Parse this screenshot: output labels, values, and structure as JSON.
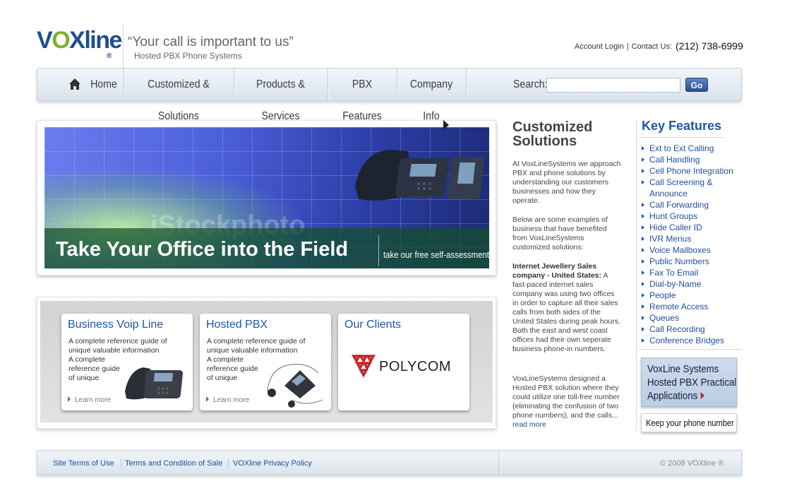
{
  "logo": {
    "part1": "V",
    "part2": "O",
    "part3": "Xline",
    "reg": "®"
  },
  "header": {
    "tagline": "“Your call is important to us”",
    "subtagline": "Hosted PBX Phone Systems",
    "account_login": "Account Login",
    "link_sep": "|",
    "contact": "Contact Us:",
    "phone": "(212) 738-6999"
  },
  "nav": {
    "items": [
      "Home",
      "Customized & Solutions",
      "Products & Services",
      "PBX Features",
      "Company Info"
    ],
    "search_label": "Search:",
    "search_placeholder": "",
    "go_label": "Go"
  },
  "hero": {
    "watermark": "iStockphoto",
    "headline": "Take Your Office into the Field",
    "cta": "take our free self-assessment"
  },
  "cards": [
    {
      "title": "Business Voip Line",
      "text1": "A complete reference guide of unique valuable information",
      "text2": "A complete reference guide of unique",
      "more": "Learn more"
    },
    {
      "title": "Hosted PBX",
      "text1": "A complete reference guide of unique valuable information",
      "text2": "A complete reference guide of unique",
      "more": "Learn more"
    },
    {
      "title": "Our Clients",
      "logo_text": "POLYCOM"
    }
  ],
  "middle": {
    "title": "Customized Solutions",
    "p1": "At VoxLineSystems we approach PBX and phone solutions by understanding our customers businesses and how they operate.",
    "p2": "Below are some examples of business that have benefited from VoxLineSystems customized solutions:",
    "p3_bold": "Internet Jewellery Sales company - United States:",
    "p3": "A fast-paced internet sales company was using two offices in order to capture all their sales calls from both sides of the United States during peak hours. Both the east and west coast offices had their own seperate business phone-in numbers.",
    "p4": "VoxLineSystems designed a Hosted PBX solution where they could utilize one toll-free number (eliminating the confusion of two phone numbers), and the calls...",
    "read_more": "read more"
  },
  "key_features": {
    "title": "Key Features",
    "items": [
      "Ext to Ext Calling",
      "Call Handling",
      "Cell Phone Integration",
      "Call Screening & Announce",
      "Call Forwarding",
      "Hunt Groups",
      "Hide Caller ID",
      "IVR Menus",
      "Voice Mailboxes",
      "Public Numbers",
      "Fax To Email",
      "Dial-by-Name",
      "People",
      "Remote Access",
      "Queues",
      "Call Recording",
      "Conference Bridges"
    ]
  },
  "promo": {
    "line1": "VoxLine Systems",
    "line2": "Hosted PBX Practical",
    "line3": "Applications"
  },
  "phone_button": "Keep your phone number",
  "footer": {
    "links": [
      "Site Terms of Use",
      "Terms and Condition of Sale",
      "VOXline Privacy Policy"
    ],
    "copyright": "© 2008 VOXline ®"
  },
  "colors": {
    "brand_blue": "#1d4e8f",
    "brand_green": "#7fb130",
    "link": "#1d4e9f",
    "accent_red": "#c0202a"
  }
}
